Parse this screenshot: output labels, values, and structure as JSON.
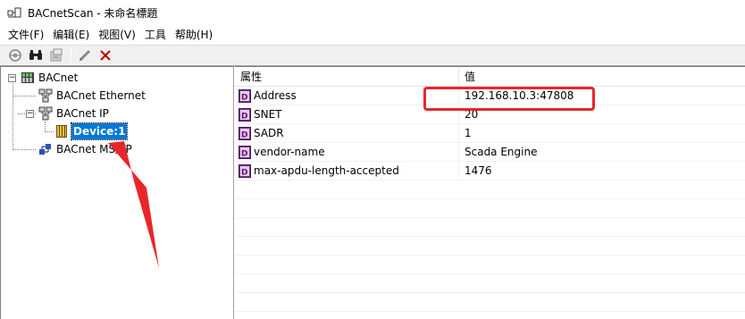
{
  "window": {
    "title": "BACnetScan - 未命名標題"
  },
  "menu": {
    "items": [
      "文件(F)",
      "编辑(E)",
      "视图(V)",
      "工具",
      "帮助(H)"
    ]
  },
  "toolbar": {
    "buttons": [
      "discover-icon",
      "find-icon",
      "properties-icon",
      "write-icon",
      "delete-icon"
    ]
  },
  "tree": {
    "root": {
      "label": "BACnet",
      "expander": "⊟"
    },
    "ethernet": {
      "label": "BACnet Ethernet"
    },
    "ip": {
      "label": "BACnet IP",
      "expander": "⊟"
    },
    "device": {
      "label": "Device:1"
    },
    "mstp": {
      "label": "BACnet MS/TP"
    }
  },
  "list": {
    "columns": [
      "属性",
      "值"
    ],
    "rows": [
      {
        "name": "Address",
        "value": "192.168.10.3:47808"
      },
      {
        "name": "SNET",
        "value": "20"
      },
      {
        "name": "SADR",
        "value": "1"
      },
      {
        "name": "vendor-name",
        "value": "Scada Engine"
      },
      {
        "name": "max-apdu-length-accepted",
        "value": "1476"
      }
    ]
  },
  "annotation": {
    "color": "#e8262a"
  }
}
